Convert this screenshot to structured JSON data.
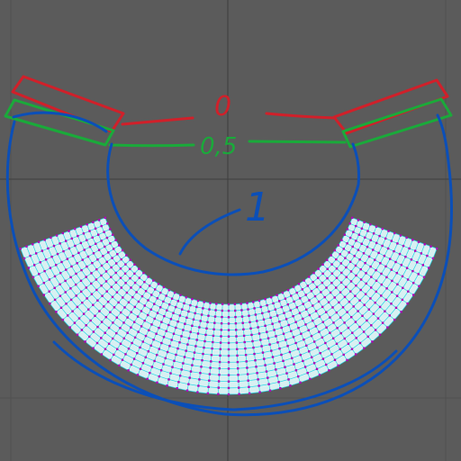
{
  "viewport": {
    "background_color": "#5b5b5b",
    "grid_color": "#505050",
    "axis_color": "#3e3e3e"
  },
  "mesh": {
    "fill_color": "#d8f0f2",
    "edge_color": "#22d6e6",
    "vertex_color": "#b000b8"
  },
  "annotations": {
    "label_0": "0",
    "label_0_5": "0,5",
    "label_1": "1",
    "color_0": "#d0202a",
    "color_0_5": "#1aaa3a",
    "color_1": "#0b4fb8"
  }
}
